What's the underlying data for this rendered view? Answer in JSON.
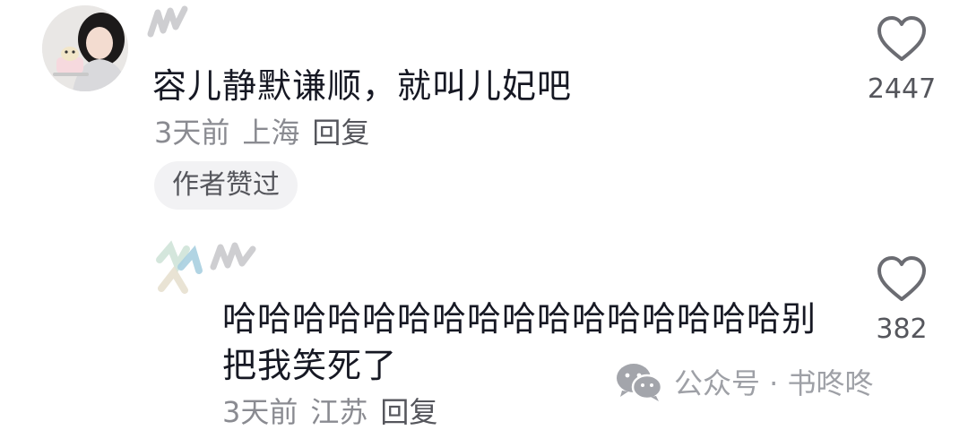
{
  "comment": {
    "text": "容儿静默谦顺，就叫儿妃吧",
    "time": "3天前",
    "location": "上海",
    "reply_label": "回复",
    "author_liked_badge": "作者赞过",
    "like_count": "2447",
    "icons": {
      "like": "heart-outline-icon",
      "avatar": "user-avatar"
    }
  },
  "reply": {
    "text": "哈哈哈哈哈哈哈哈哈哈哈哈哈哈哈哈别把我笑死了",
    "time": "3天前",
    "location": "江苏",
    "reply_label": "回复",
    "like_count": "382",
    "icons": {
      "like": "heart-outline-icon",
      "avatar": "user-avatar"
    }
  },
  "watermark": {
    "text": "公众号 · 书咚咚",
    "icon": "wechat-icon"
  },
  "colors": {
    "primary_text": "#161823",
    "secondary_text": "#8a8b91",
    "badge_bg": "#f2f2f4",
    "watermark": "#9ea0a6"
  }
}
